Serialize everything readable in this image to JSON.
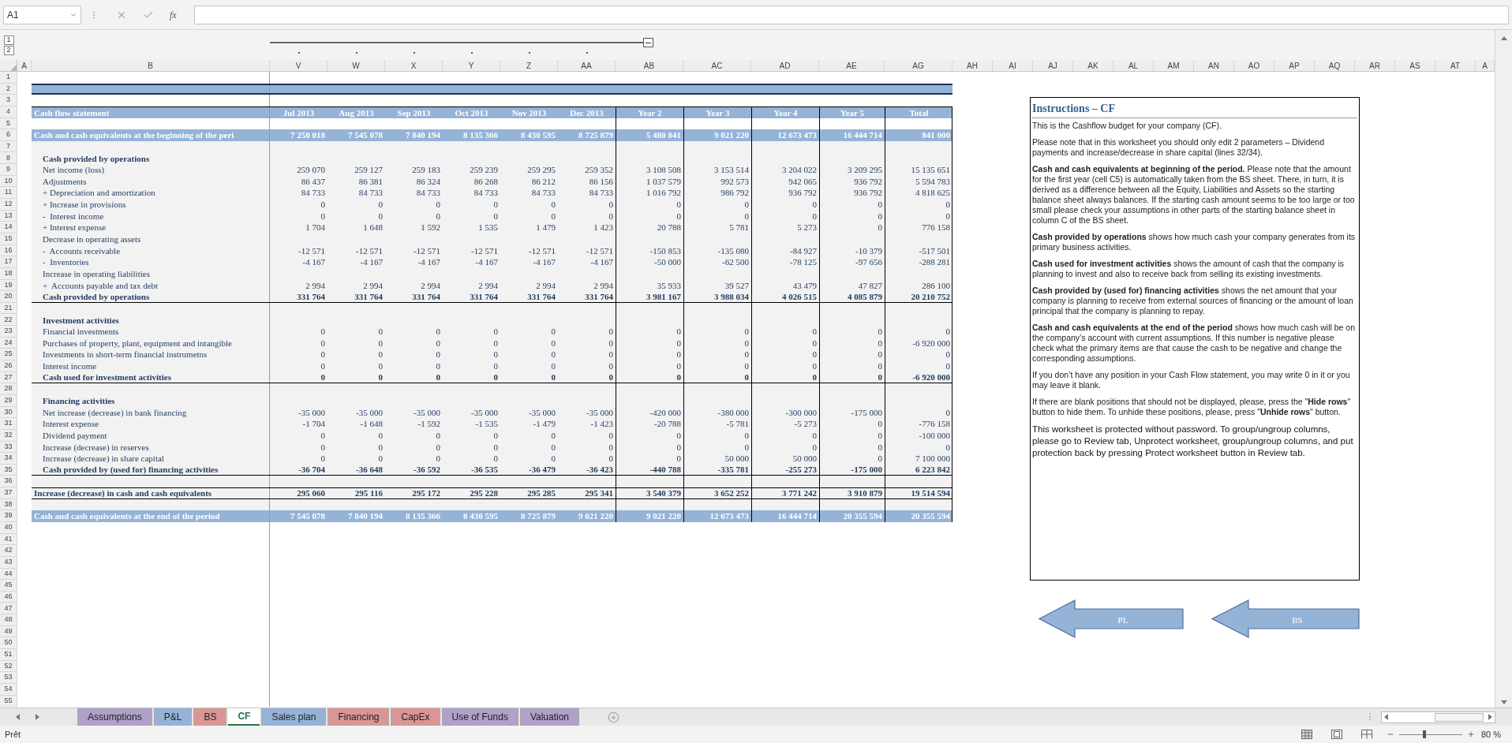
{
  "name_box": "A1",
  "function_button": "fx",
  "outline_levels": [
    "1",
    "2"
  ],
  "column_headers": [
    "A",
    "B",
    "V",
    "W",
    "X",
    "Y",
    "Z",
    "AA",
    "AB",
    "AC",
    "AD",
    "AE",
    "AG",
    "AH",
    "AI",
    "AJ",
    "AK",
    "AL",
    "AM",
    "AN",
    "AO",
    "AP",
    "AQ",
    "AR",
    "AS",
    "AT",
    "A"
  ],
  "rows": [
    {
      "number": "1",
      "kind": "blank"
    },
    {
      "number": "2",
      "kind": "band"
    },
    {
      "number": "3",
      "kind": "blank"
    },
    {
      "number": "4",
      "kind": "header",
      "label": "Cash flow statement",
      "values": [
        "Jul 2013",
        "Aug 2013",
        "Sep 2013",
        "Oct 2013",
        "Nov 2013",
        "Dec 2013",
        "Year 2",
        "Year 3",
        "Year 4",
        "Year 5",
        "Total"
      ]
    },
    {
      "number": "5",
      "kind": "gap"
    },
    {
      "number": "6",
      "kind": "highlight",
      "label": "Cash and cash equivalents at the beginning of the peri",
      "values": [
        "7 250 018",
        "7 545 078",
        "7 840 194",
        "8 135 366",
        "8 430 595",
        "8 725 879",
        "5 480 841",
        "9 021 220",
        "12 673 473",
        "16 444 714",
        "841 000"
      ]
    },
    {
      "number": "7",
      "kind": "filler"
    },
    {
      "number": "8",
      "kind": "section",
      "label": "Cash provided by operations"
    },
    {
      "number": "9",
      "kind": "item",
      "label": "Net income (loss)",
      "values": [
        "259 070",
        "259 127",
        "259 183",
        "259 239",
        "259 295",
        "259 352",
        "3 108 508",
        "3 153 514",
        "3 204 022",
        "3 209 295",
        "15 135 651"
      ]
    },
    {
      "number": "10",
      "kind": "item",
      "label": "Adjustments",
      "values": [
        "86 437",
        "86 381",
        "86 324",
        "86 268",
        "86 212",
        "86 156",
        "1 037 579",
        "992 573",
        "942 065",
        "936 792",
        "5 594 783"
      ]
    },
    {
      "number": "11",
      "kind": "item",
      "label": "+ Depreciation and amortization",
      "values": [
        "84 733",
        "84 733",
        "84 733",
        "84 733",
        "84 733",
        "84 733",
        "1 016 792",
        "986 792",
        "936 792",
        "936 792",
        "4 818 625"
      ]
    },
    {
      "number": "12",
      "kind": "item",
      "label": "+ Increase in provisions",
      "values": [
        "0",
        "0",
        "0",
        "0",
        "0",
        "0",
        "0",
        "0",
        "0",
        "0",
        "0"
      ]
    },
    {
      "number": "13",
      "kind": "item",
      "label": "-  Interest income",
      "values": [
        "0",
        "0",
        "0",
        "0",
        "0",
        "0",
        "0",
        "0",
        "0",
        "0",
        "0"
      ]
    },
    {
      "number": "14",
      "kind": "item",
      "label": "+ Interest expense",
      "values": [
        "1 704",
        "1 648",
        "1 592",
        "1 535",
        "1 479",
        "1 423",
        "20 788",
        "5 781",
        "5 273",
        "0",
        "776 158"
      ]
    },
    {
      "number": "15",
      "kind": "subsection",
      "label": "Decrease in operating assets"
    },
    {
      "number": "16",
      "kind": "item",
      "label": "-  Accounts receivable",
      "values": [
        "-12 571",
        "-12 571",
        "-12 571",
        "-12 571",
        "-12 571",
        "-12 571",
        "-150 853",
        "-135 080",
        "-84 927",
        "-10 379",
        "-517 501"
      ]
    },
    {
      "number": "17",
      "kind": "item",
      "label": "-  Inventories",
      "values": [
        "-4 167",
        "-4 167",
        "-4 167",
        "-4 167",
        "-4 167",
        "-4 167",
        "-50 000",
        "-62 500",
        "-78 125",
        "-97 656",
        "-288 281"
      ]
    },
    {
      "number": "18",
      "kind": "subsection",
      "label": "Increase in operating liabilities"
    },
    {
      "number": "19",
      "kind": "item",
      "label": "+  Accounts payable and tax debt",
      "values": [
        "2 994",
        "2 994",
        "2 994",
        "2 994",
        "2 994",
        "2 994",
        "35 933",
        "39 527",
        "43 479",
        "47 827",
        "286 100"
      ]
    },
    {
      "number": "20",
      "kind": "total",
      "label": "Cash provided by operations",
      "values": [
        "331 764",
        "331 764",
        "331 764",
        "331 764",
        "331 764",
        "331 764",
        "3 981 167",
        "3 988 034",
        "4 026 515",
        "4 085 879",
        "20 210 752"
      ]
    },
    {
      "number": "21",
      "kind": "filler"
    },
    {
      "number": "22",
      "kind": "section",
      "label": "Investment activities"
    },
    {
      "number": "23",
      "kind": "item",
      "label": "Financial investments",
      "values": [
        "0",
        "0",
        "0",
        "0",
        "0",
        "0",
        "0",
        "0",
        "0",
        "0",
        "0"
      ]
    },
    {
      "number": "24",
      "kind": "item",
      "label": "Purchases of property, plant, equipment and intangible",
      "values": [
        "0",
        "0",
        "0",
        "0",
        "0",
        "0",
        "0",
        "0",
        "0",
        "0",
        "-6 920 000"
      ]
    },
    {
      "number": "25",
      "kind": "item",
      "label": "Investments in short-term financial instrumetns",
      "values": [
        "0",
        "0",
        "0",
        "0",
        "0",
        "0",
        "0",
        "0",
        "0",
        "0",
        "0"
      ]
    },
    {
      "number": "26",
      "kind": "item",
      "label": "Interest income",
      "values": [
        "0",
        "0",
        "0",
        "0",
        "0",
        "0",
        "0",
        "0",
        "0",
        "0",
        "0"
      ]
    },
    {
      "number": "27",
      "kind": "total",
      "label": "Cash used for investment activities",
      "values": [
        "0",
        "0",
        "0",
        "0",
        "0",
        "0",
        "0",
        "0",
        "0",
        "0",
        "-6 920 000"
      ]
    },
    {
      "number": "28",
      "kind": "filler"
    },
    {
      "number": "29",
      "kind": "section",
      "label": "Financing activities"
    },
    {
      "number": "30",
      "kind": "item",
      "label": "Net increase (decrease) in bank financing",
      "values": [
        "-35 000",
        "-35 000",
        "-35 000",
        "-35 000",
        "-35 000",
        "-35 000",
        "-420 000",
        "-380 000",
        "-300 000",
        "-175 000",
        "0"
      ]
    },
    {
      "number": "31",
      "kind": "item",
      "label": "Interest expense",
      "values": [
        "-1 704",
        "-1 648",
        "-1 592",
        "-1 535",
        "-1 479",
        "-1 423",
        "-20 788",
        "-5 781",
        "-5 273",
        "0",
        "-776 158"
      ]
    },
    {
      "number": "32",
      "kind": "item",
      "label": "Dividend payment",
      "values": [
        "0",
        "0",
        "0",
        "0",
        "0",
        "0",
        "0",
        "0",
        "0",
        "0",
        "-100 000"
      ]
    },
    {
      "number": "33",
      "kind": "item",
      "label": "Increase (decrease) in reserves",
      "values": [
        "0",
        "0",
        "0",
        "0",
        "0",
        "0",
        "0",
        "0",
        "0",
        "0",
        "0"
      ]
    },
    {
      "number": "34",
      "kind": "item",
      "label": "Increase (decrease) in share capital",
      "values": [
        "0",
        "0",
        "0",
        "0",
        "0",
        "0",
        "0",
        "50 000",
        "50 000",
        "0",
        "7 100 000"
      ]
    },
    {
      "number": "35",
      "kind": "total",
      "label": "Cash provided by (used for) financing activities",
      "values": [
        "-36 704",
        "-36 648",
        "-36 592",
        "-36 535",
        "-36 479",
        "-36 423",
        "-440 788",
        "-335 781",
        "-255 273",
        "-175 000",
        "6 223 842"
      ]
    },
    {
      "number": "36",
      "kind": "filler"
    },
    {
      "number": "37",
      "kind": "sum",
      "label": "Increase (decrease) in cash and cash equivalents",
      "values": [
        "295 060",
        "295 116",
        "295 172",
        "295 228",
        "295 285",
        "295 341",
        "3 540 379",
        "3 652 252",
        "3 771 242",
        "3 910 879",
        "19 514 594"
      ]
    },
    {
      "number": "38",
      "kind": "filler"
    },
    {
      "number": "39",
      "kind": "highlight",
      "label": "Cash and cash equivalents at the end of the period",
      "values": [
        "7 545 078",
        "7 840 194",
        "8 135 366",
        "8 430 595",
        "8 725 879",
        "9 021 220",
        "9 021 220",
        "12 673 473",
        "16 444 714",
        "20 355 594",
        "20 355 594"
      ]
    },
    {
      "number": "40",
      "kind": "blank"
    },
    {
      "number": "41",
      "kind": "blank"
    },
    {
      "number": "42",
      "kind": "blank"
    },
    {
      "number": "43",
      "kind": "blank"
    },
    {
      "number": "44",
      "kind": "blank"
    },
    {
      "number": "45",
      "kind": "blank"
    },
    {
      "number": "46",
      "kind": "blank"
    },
    {
      "number": "47",
      "kind": "blank"
    },
    {
      "number": "48",
      "kind": "blank"
    },
    {
      "number": "49",
      "kind": "blank"
    },
    {
      "number": "50",
      "kind": "blank"
    },
    {
      "number": "51",
      "kind": "blank"
    },
    {
      "number": "52",
      "kind": "blank"
    },
    {
      "number": "53",
      "kind": "blank"
    },
    {
      "number": "54",
      "kind": "blank"
    },
    {
      "number": "55",
      "kind": "blank"
    }
  ],
  "instructions": {
    "title": "Instructions – CF",
    "paragraphs": [
      "This is the Cashflow budget for your company (CF).",
      "Please note that in this worksheet you should only edit 2 parameters – Dividend payments and increase/decrease in share capital (lines 32/34).",
      "**Cash and cash equivalents at beginning of the period.** Please note that the amount for the first year (cell C5) is automatically taken from the BS sheet. There, in turn, it is derived as a difference between all the Equity, Liabilities and Assets so the starting balance sheet always balances. If the starting cash amount seems to be too large or too small please check your assumptions in other parts of the starting balance sheet in column C of the BS sheet.",
      "**Cash provided by operations** shows how much cash your company generates from its primary business activities.",
      "**Cash used for investment activities** shows the amount of cash that the company is planning to invest and also to receive back from selling its existing investments.",
      "**Cash provided by (used for) financing activities** shows the net amount that your company is planning to receive from external sources of financing or the amount of loan principal that the company is planning to repay.",
      "**Cash and cash equivalents at the end of the period** shows how much cash will be on the company’s account with current assumptions. If this number is negative please check what the primary items are that cause the cash to be negative and change the corresponding assumptions.",
      "If you don’t have any position in your Cash Flow statement, you may write 0 in it or you may leave it blank.",
      "If there are blank positions that should not be displayed, please, press the \"**Hide rows**\" button to hide them. To unhide these positions, please, press \"**Unhide rows**\" button."
    ],
    "note": "This worksheet is protected without password. To group/ungroup columns, please go to Review tab, Unprotect worksheet, group/ungroup columns, and put protection back by pressing Protect worksheet button in Review tab."
  },
  "nav_buttons": [
    "PL",
    "BS"
  ],
  "tabs": [
    {
      "label": "Assumptions",
      "color": "#b1a0c7",
      "selected": false
    },
    {
      "label": "P&L",
      "color": "#95b3d7",
      "selected": false
    },
    {
      "label": "BS",
      "color": "#da9694",
      "selected": false
    },
    {
      "label": "CF",
      "color": "#217346",
      "selected": true
    },
    {
      "label": "Sales plan",
      "color": "#95b3d7",
      "selected": false
    },
    {
      "label": "Financing",
      "color": "#da9694",
      "selected": false
    },
    {
      "label": "CapEx",
      "color": "#da9694",
      "selected": false
    },
    {
      "label": "Use of Funds",
      "color": "#b1a0c7",
      "selected": false
    },
    {
      "label": "Valuation",
      "color": "#b1a0c7",
      "selected": false
    }
  ],
  "status": "Prêt",
  "zoom": {
    "level": 0.4,
    "reading": "80 %"
  }
}
